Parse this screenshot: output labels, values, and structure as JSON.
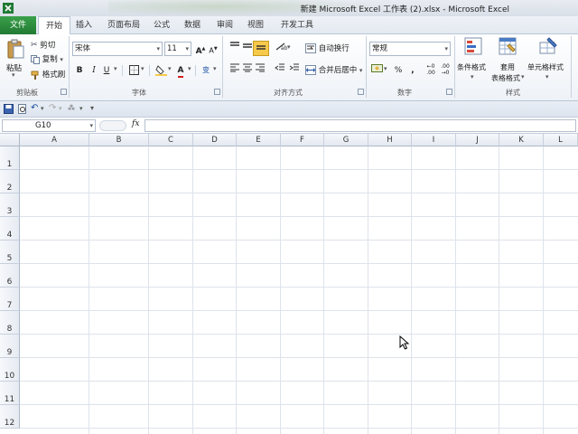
{
  "window": {
    "title": "新建 Microsoft Excel 工作表 (2).xlsx - Microsoft Excel"
  },
  "tabs": {
    "file": "文件",
    "items": [
      "开始",
      "插入",
      "页面布局",
      "公式",
      "数据",
      "审阅",
      "视图",
      "开发工具"
    ]
  },
  "ribbon": {
    "clipboard": {
      "paste": "粘贴",
      "cut": "剪切",
      "copy": "复制",
      "format_painter": "格式刷",
      "label": "剪贴板"
    },
    "font": {
      "font_name": "宋体",
      "font_size": "11",
      "bold": "B",
      "italic": "I",
      "underline": "U",
      "wen": "变",
      "grow": "A",
      "shrink": "A",
      "label": "字体"
    },
    "alignment": {
      "wrap_text": "自动换行",
      "merge_center": "合并后居中",
      "label": "对齐方式"
    },
    "number": {
      "format": "常规",
      "percent": "%",
      "comma": ",",
      "label": "数字"
    },
    "styles": {
      "conditional": "条件格式",
      "table_format_line1": "套用",
      "table_format_line2": "表格格式",
      "cell_styles": "单元格样式",
      "label": "样式"
    }
  },
  "formula_bar": {
    "name_box": "G10",
    "fx": "fx",
    "formula": ""
  },
  "sheet": {
    "columns": [
      "A",
      "B",
      "C",
      "D",
      "E",
      "F",
      "G",
      "H",
      "I",
      "J",
      "K",
      "L"
    ],
    "rows": [
      "1",
      "2",
      "3",
      "4",
      "5",
      "6",
      "7",
      "8",
      "9",
      "10",
      "11",
      "12"
    ]
  },
  "colors": {
    "file_tab": "#217a33",
    "highlight_yellow": "#f6c94a",
    "font_red": "#d42020"
  }
}
